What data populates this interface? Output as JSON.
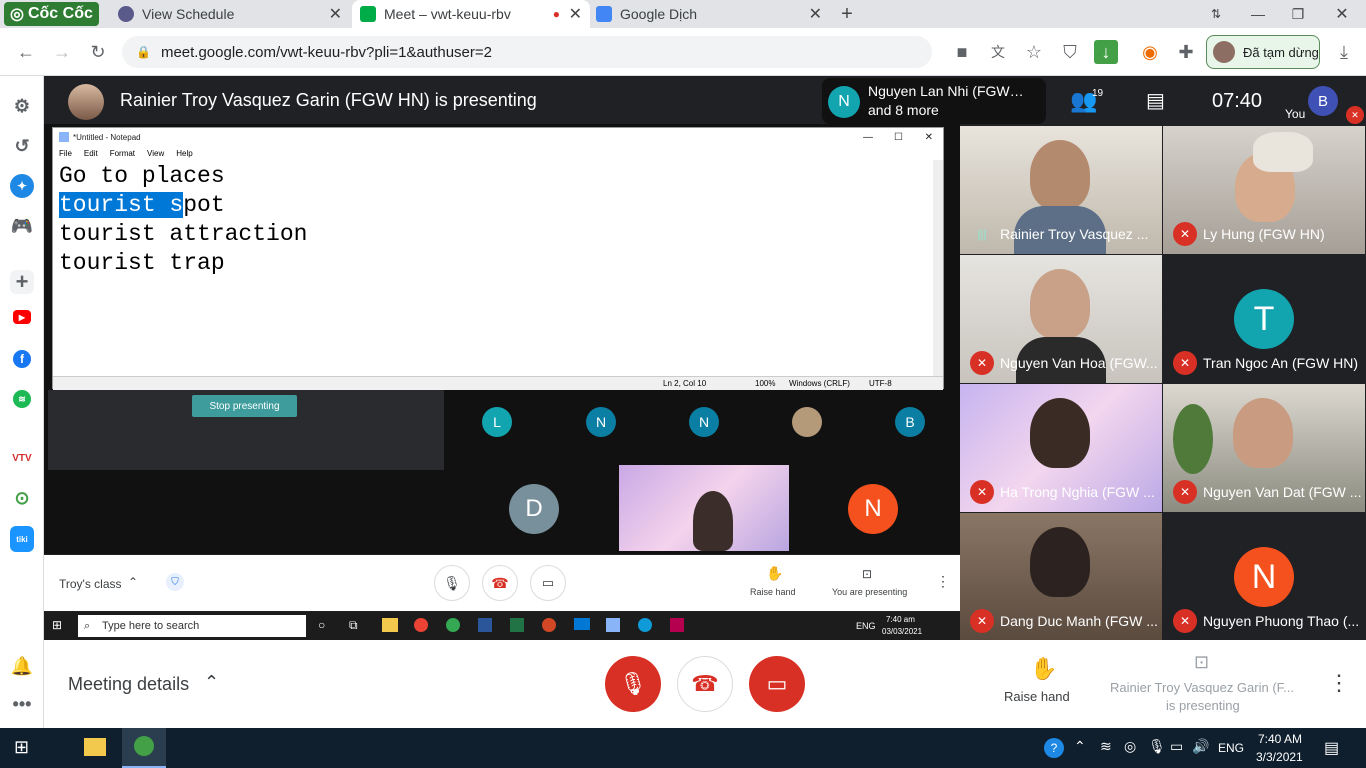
{
  "browser": {
    "tabs": [
      {
        "title": "Cốc Cốc"
      },
      {
        "title": "View Schedule"
      },
      {
        "title": "Meet – vwt-keuu-rbv"
      },
      {
        "title": "Google Dịch"
      }
    ],
    "url": "meet.google.com/vwt-keuu-rbv?pli=1&authuser=2",
    "paused_label": "Đã tạm dừng"
  },
  "meet": {
    "presenter_title": "Rainier Troy Vasquez Garin (FGW HN) is presenting",
    "badge_initial": "N",
    "badge_line1": "Nguyen Lan Nhi (FGW…",
    "badge_line2": "and 8 more",
    "participant_count": "19",
    "time": "07:40",
    "you_label": "You",
    "you_initial": "B",
    "meeting_details": "Meeting details",
    "raise_hand": "Raise hand",
    "presenting_line1": "Rainier Troy Vasquez Garin (F...",
    "presenting_line2": "is presenting"
  },
  "notepad": {
    "title": "*Untitled - Notepad",
    "menu": [
      "File",
      "Edit",
      "Format",
      "View",
      "Help"
    ],
    "lines": {
      "line1": "Go to places",
      "line2_selected": "tourist s",
      "line2_rest": "pot",
      "line3": "tourist attraction",
      "line4": "tourist trap"
    },
    "status": {
      "position": "Ln 2, Col 10",
      "zoom": "100%",
      "eol": "Windows (CRLF)",
      "encoding": "UTF-8"
    }
  },
  "inner_meet": {
    "stop_presenting": "Stop presenting",
    "class_name": "Troy's class",
    "raise_hand": "Raise hand",
    "you_are_presenting": "You are presenting",
    "mini_avatars": [
      "L",
      "N",
      "N",
      "",
      "B"
    ],
    "big_avatars": [
      "D",
      "N"
    ],
    "search_placeholder": "Type here to search",
    "lang": "ENG",
    "time": "7:40 am",
    "date": "03/03/2021"
  },
  "participants": [
    {
      "name": "Rainier Troy Vasquez ...",
      "muted": false,
      "has_video": true
    },
    {
      "name": "Ly Hung (FGW HN)",
      "muted": true,
      "has_video": true
    },
    {
      "name": "Nguyen Van Hoa (FGW...",
      "muted": true,
      "has_video": true
    },
    {
      "name": "Tran Ngoc An (FGW HN)",
      "muted": true,
      "has_video": false,
      "initial": "T",
      "color": "#12a4af"
    },
    {
      "name": "Ha Trong Nghia (FGW ...",
      "muted": true,
      "has_video": true
    },
    {
      "name": "Nguyen Van Dat (FGW ...",
      "muted": true,
      "has_video": true
    },
    {
      "name": "Dang Duc Manh (FGW ...",
      "muted": true,
      "has_video": true
    },
    {
      "name": "Nguyen Phuong Thao (...",
      "muted": true,
      "has_video": false,
      "initial": "N",
      "color": "#f4511e"
    }
  ],
  "os": {
    "lang": "ENG",
    "time": "7:40 AM",
    "date": "3/3/2021"
  },
  "colors": {
    "meet_red": "#d93025",
    "teal": "#12a4af",
    "orange": "#f4511e",
    "selection": "#0078d7"
  }
}
